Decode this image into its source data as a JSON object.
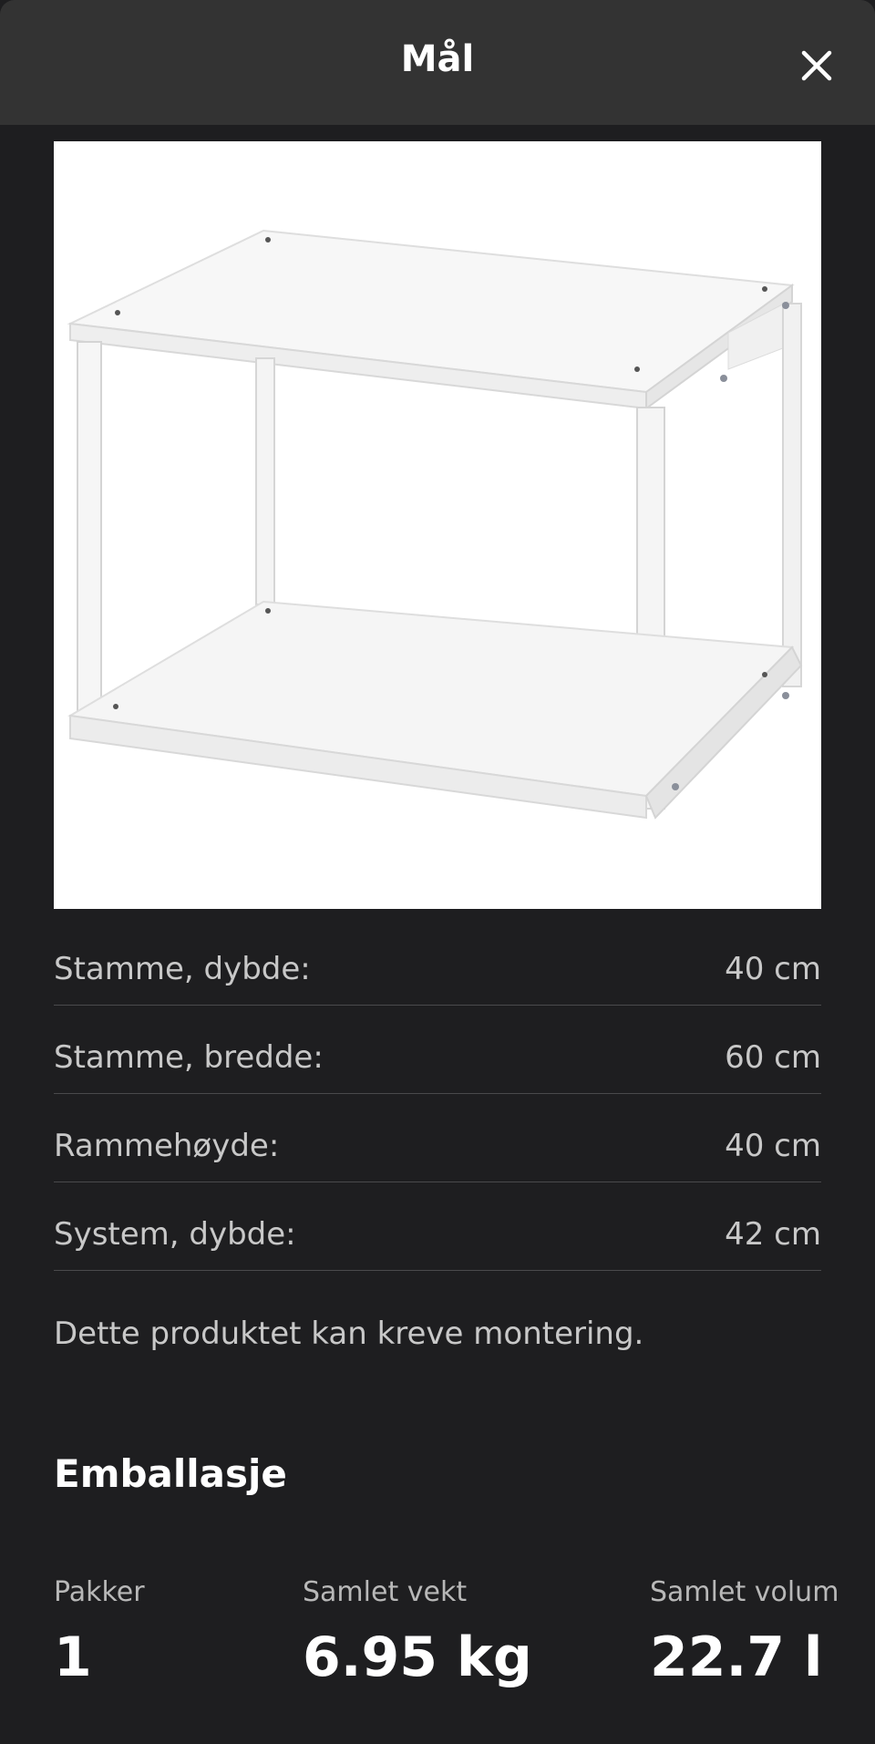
{
  "header": {
    "title": "Mål"
  },
  "image": {
    "icon": "product-shelf-image"
  },
  "specs": [
    {
      "label": "Stamme, dybde:",
      "value": "40 cm"
    },
    {
      "label": "Stamme, bredde:",
      "value": "60 cm"
    },
    {
      "label": "Rammehøyde:",
      "value": "40 cm"
    },
    {
      "label": "System, dybde:",
      "value": "42 cm"
    }
  ],
  "note": "Dette produktet kan kreve montering.",
  "packaging": {
    "title": "Emballasje",
    "stats": [
      {
        "label": "Pakker",
        "value": "1"
      },
      {
        "label": "Samlet vekt",
        "value": "6.95 kg"
      },
      {
        "label": "Samlet volum",
        "value": "22.7 l"
      }
    ]
  },
  "colors": {
    "background": "#1e1e20",
    "header": "#333333",
    "divider": "#4a4a4c"
  }
}
